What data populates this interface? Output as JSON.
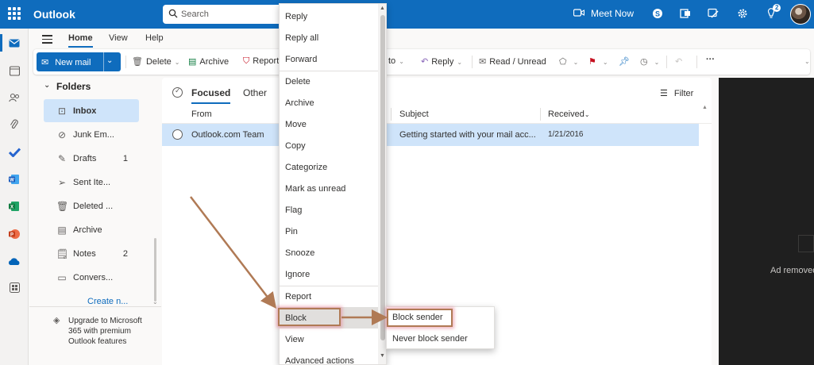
{
  "app": {
    "name": "Outlook"
  },
  "search": {
    "placeholder": "Search"
  },
  "topbar": {
    "meet_now": "Meet Now",
    "notification_count": "2",
    "icons": [
      "waffle-icon",
      "video-icon",
      "skype-icon",
      "office-icon",
      "feedback-icon",
      "settings-icon",
      "tips-icon"
    ]
  },
  "ribbon_tabs": [
    "Home",
    "View",
    "Help"
  ],
  "ribbon": {
    "new_mail": "New mail",
    "delete": "Delete",
    "archive": "Archive",
    "report": "Report",
    "move_to": "to",
    "reply": "Reply",
    "read_unread": "Read / Unread",
    "more": "···"
  },
  "folders": {
    "header": "Folders",
    "items": [
      {
        "label": "Inbox",
        "count": "",
        "icon": "inbox-icon"
      },
      {
        "label": "Junk Em...",
        "count": "",
        "icon": "junk-icon"
      },
      {
        "label": "Drafts",
        "count": "1",
        "icon": "draft-icon"
      },
      {
        "label": "Sent Ite...",
        "count": "",
        "icon": "send-icon"
      },
      {
        "label": "Deleted ...",
        "count": "",
        "icon": "trash-icon"
      },
      {
        "label": "Archive",
        "count": "",
        "icon": "archive-icon"
      },
      {
        "label": "Notes",
        "count": "2",
        "icon": "note-icon"
      },
      {
        "label": "Convers...",
        "count": "",
        "icon": "folder-icon"
      }
    ],
    "create_new": "Create n...",
    "upgrade": "Upgrade to Microsoft 365 with premium Outlook features"
  },
  "message_list": {
    "pivots": [
      "Focused",
      "Other"
    ],
    "filter": "Filter",
    "columns": {
      "from": "From",
      "subject": "Subject",
      "received": "Received"
    },
    "rows": [
      {
        "from": "Outlook.com Team",
        "subject": "Getting started with your mail acc...",
        "received": "1/21/2016"
      }
    ]
  },
  "context_menu": {
    "items": [
      "Reply",
      "Reply all",
      "Forward",
      "Delete",
      "Archive",
      "Move",
      "Copy",
      "Categorize",
      "Mark as unread",
      "Flag",
      "Pin",
      "Snooze",
      "Ignore",
      "Report",
      "Block",
      "View",
      "Advanced actions"
    ],
    "highlighted": "Block"
  },
  "submenu": {
    "items": [
      "Block sender",
      "Never block sender"
    ]
  },
  "ad": {
    "text": "Ad removed"
  },
  "colors": {
    "brand": "#0f6cbd",
    "selected": "#cfe4fa",
    "annotation": "#b07a55"
  }
}
